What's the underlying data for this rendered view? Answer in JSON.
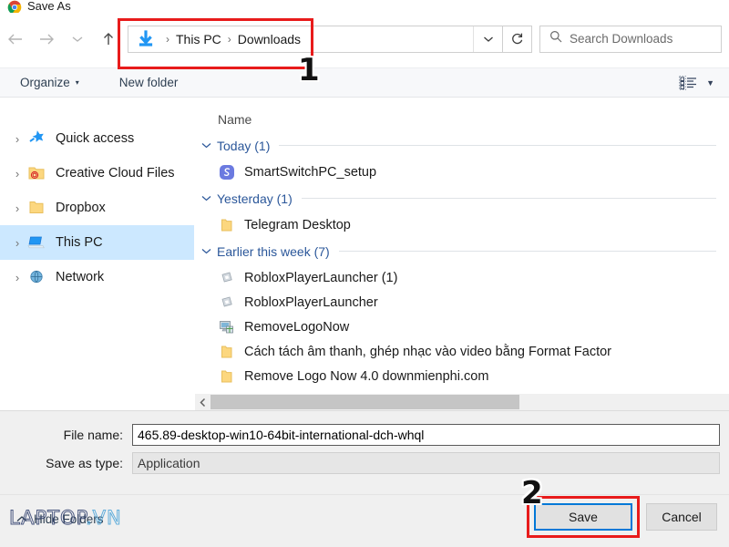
{
  "window": {
    "title": "Save As",
    "app_icon": "chrome-icon"
  },
  "nav": {
    "back_icon": "arrow-left-icon",
    "forward_icon": "arrow-right-icon",
    "recent_icon": "chevron-down-icon",
    "up_icon": "arrow-up-icon",
    "breadcrumb_icon": "downloads-arrow-icon",
    "breadcrumb": [
      "This PC",
      "Downloads"
    ],
    "breadcrumb_separator": "›",
    "dropdown_icon": "chevron-down-icon",
    "refresh_icon": "refresh-icon",
    "search": {
      "icon": "search-icon",
      "placeholder": "Search Downloads",
      "value": ""
    }
  },
  "toolbar": {
    "organize_label": "Organize",
    "organize_caret": "▾",
    "new_folder_label": "New folder",
    "view_icon": "list-view-icon",
    "view_caret": "▼"
  },
  "sidebar": {
    "items": [
      {
        "label": "Quick access",
        "icon": "star-icon",
        "selected": false,
        "chevron": "›"
      },
      {
        "label": "Creative Cloud Files",
        "icon": "creative-cloud-icon",
        "selected": false,
        "chevron": "›"
      },
      {
        "label": "Dropbox",
        "icon": "folder-icon",
        "selected": false,
        "chevron": "›"
      },
      {
        "label": "This PC",
        "icon": "this-pc-icon",
        "selected": true,
        "chevron": "›"
      },
      {
        "label": "Network",
        "icon": "network-icon",
        "selected": false,
        "chevron": "›"
      }
    ]
  },
  "filelist": {
    "column_header": "Name",
    "groups": [
      {
        "label": "Today (1)",
        "chevron": "⌄",
        "files": [
          {
            "name": "SmartSwitchPC_setup",
            "icon": "smartswitch-icon"
          }
        ]
      },
      {
        "label": "Yesterday (1)",
        "chevron": "⌄",
        "files": [
          {
            "name": "Telegram Desktop",
            "icon": "folder-icon"
          }
        ]
      },
      {
        "label": "Earlier this week (7)",
        "chevron": "⌄",
        "files": [
          {
            "name": "RobloxPlayerLauncher (1)",
            "icon": "roblox-icon"
          },
          {
            "name": "RobloxPlayerLauncher",
            "icon": "roblox-icon"
          },
          {
            "name": "RemoveLogoNow",
            "icon": "installer-icon"
          },
          {
            "name": "Cách tách âm thanh, ghép nhạc vào video bằng Format Factor",
            "icon": "folder-icon"
          },
          {
            "name": "Remove Logo Now 4.0 downmienphi.com",
            "icon": "folder-icon"
          }
        ]
      }
    ],
    "hscroll_left_icon": "chevron-left-icon"
  },
  "form": {
    "file_name_label": "File name:",
    "file_name_value": "465.89-desktop-win10-64bit-international-dch-whql",
    "file_name_placeholder": "File name",
    "save_as_type_label": "Save as type:",
    "save_as_type_value": "Application"
  },
  "footer": {
    "hide_folders_label": "Hide Folders",
    "hide_folders_chevron": "⌃",
    "save_label": "Save",
    "cancel_label": "Cancel"
  },
  "annotations": {
    "step1": "1",
    "step2": "2",
    "color": "#e81b1b"
  },
  "watermark": {
    "text_a": "LAPTOP",
    "text_b": ".VN"
  },
  "colors": {
    "accent": "#0078d7",
    "selection": "#cce8ff",
    "link": "#2b579a",
    "annotation": "#e81b1b"
  }
}
